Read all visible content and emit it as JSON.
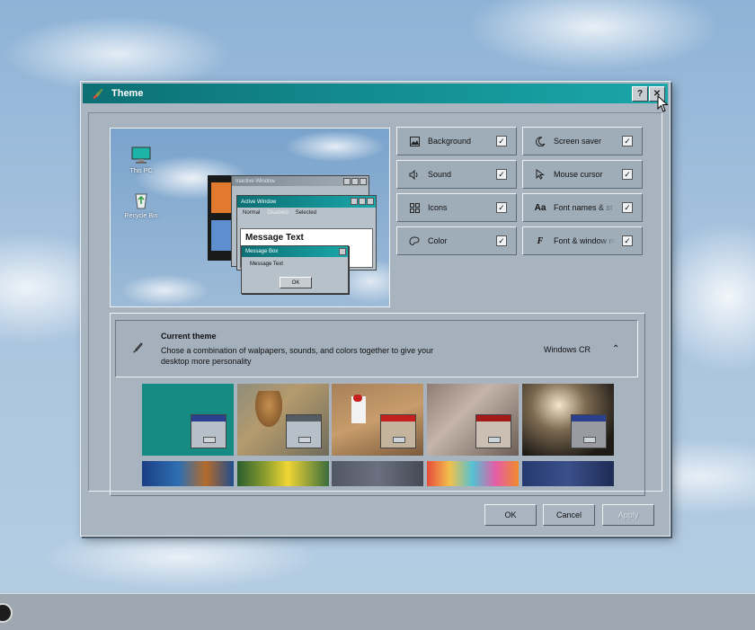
{
  "window": {
    "title": "Theme",
    "help_label": "?",
    "close_label": "✕"
  },
  "preview": {
    "desktop_icons": [
      {
        "label": "This PC",
        "icon": "monitor-icon"
      },
      {
        "label": "Recycle Bin",
        "icon": "recycle-bin-icon"
      }
    ],
    "inactive_window": {
      "title": "Inactive Window"
    },
    "active_window": {
      "title": "Active Window",
      "menu": [
        "Normal",
        "Disabled",
        "Selected"
      ],
      "body_text": "Message Text"
    },
    "message_box": {
      "title": "Message Box",
      "text": "Message Text",
      "ok_label": "OK"
    }
  },
  "options": [
    {
      "label": "Background",
      "icon": "background-icon",
      "checked": true
    },
    {
      "label": "Screen saver",
      "icon": "screen-saver-icon",
      "checked": true
    },
    {
      "label": "Sound",
      "icon": "sound-icon",
      "checked": true
    },
    {
      "label": "Mouse cursor",
      "icon": "mouse-cursor-icon",
      "checked": true
    },
    {
      "label": "Icons",
      "icon": "icons-icon",
      "checked": true
    },
    {
      "label": "Font names & st",
      "icon": "font-names-icon",
      "glyph": "Aa",
      "checked": true
    },
    {
      "label": "Color",
      "icon": "color-icon",
      "checked": true
    },
    {
      "label": "Font & window m",
      "icon": "font-window-icon",
      "glyph": "F",
      "checked": true
    }
  ],
  "current_theme": {
    "title": "Current theme",
    "description": "Chose a combination of walpapers, sounds, and colors together to give your desktop more personality",
    "value": "Windows CR",
    "chevron": "⌃"
  },
  "thumbnails_colors": {
    "teal": "#158b84",
    "accent_red": "#c6201e",
    "accent_blue": "#2b3f8f"
  },
  "buttons": {
    "ok": "OK",
    "cancel": "Cancel",
    "apply": "Apply"
  }
}
